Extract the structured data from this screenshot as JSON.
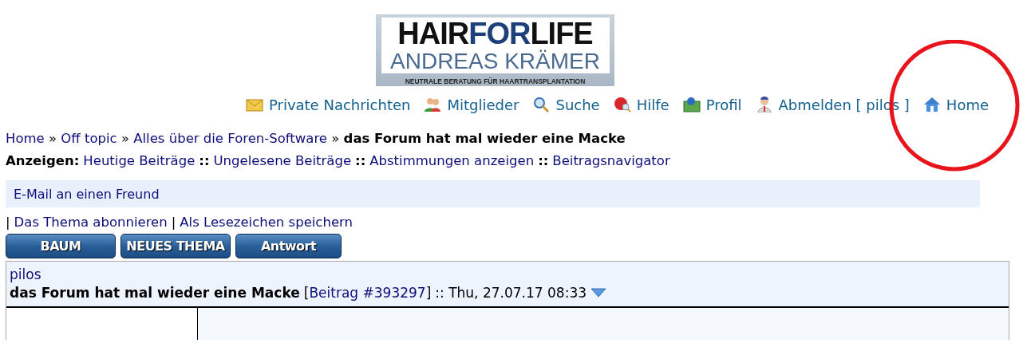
{
  "logo": {
    "brand": [
      "HAIR",
      "FOR",
      "LIFE"
    ],
    "name": "ANDREAS KRÄMER",
    "tagline": "NEUTRALE BERATUNG FÜR HAARTRANSPLANTATION"
  },
  "nav": [
    {
      "kind": "mail",
      "label": "Private Nachrichten"
    },
    {
      "kind": "members",
      "label": "Mitglieder"
    },
    {
      "kind": "search",
      "label": "Suche"
    },
    {
      "kind": "help",
      "label": "Hilfe"
    },
    {
      "kind": "profile",
      "label": "Profil"
    },
    {
      "kind": "logout",
      "label": "Abmelden [ pilos ]"
    },
    {
      "kind": "home",
      "label": "Home"
    }
  ],
  "breadcrumb": {
    "links": [
      "Home",
      "Off topic",
      "Alles über die Foren-Software"
    ],
    "separator": "»",
    "current": "das Forum hat mal wieder eine Macke"
  },
  "show": {
    "label": "Anzeigen:",
    "separator": "::",
    "links": [
      "Heutige Beiträge",
      "Ungelesene Beiträge",
      "Abstimmungen anzeigen",
      "Beitragsnavigator"
    ]
  },
  "email_bar": {
    "link": "E-Mail an einen Freund"
  },
  "thread_links": {
    "separator": "|",
    "links": [
      "Das Thema abonnieren",
      "Als Lesezeichen speichern"
    ]
  },
  "buttons": [
    "BAUM",
    "NEUES THEMA",
    "Antwort"
  ],
  "post": {
    "author": "pilos",
    "subject": "das Forum hat mal wieder eine Macke",
    "ref_open": "[",
    "ref": "Beitrag #393297",
    "ref_close": "]",
    "date": ":: Thu, 27.07.17 08:33"
  },
  "annotation": {
    "kind": "circle",
    "color": "#e8141c"
  }
}
